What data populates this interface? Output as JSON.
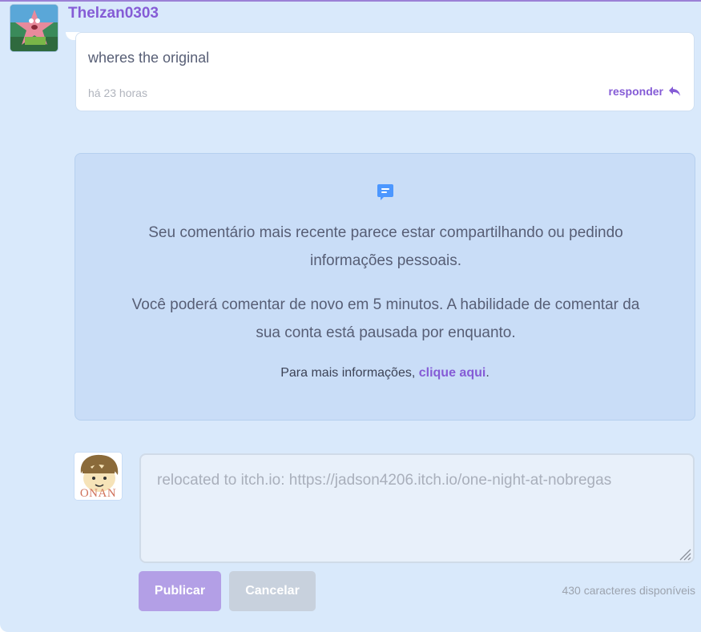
{
  "comment": {
    "author": "Thelzan0303",
    "text": "wheres the original",
    "time": "há 23 horas",
    "reply_label": "responder",
    "avatar_icon": "user-avatar-starfish"
  },
  "notice": {
    "icon": "chat-bubble-icon",
    "line1": "Seu comentário mais recente parece estar compartilhando ou pedindo informações pessoais.",
    "line2": "Você poderá comentar de novo em 5 minutos. A habilidade de comentar da sua conta está pausada por enquanto.",
    "more_info_prefix": "Para mais informações, ",
    "more_info_link": "clique aqui",
    "more_info_suffix": "."
  },
  "compose": {
    "avatar_text": "ONAN",
    "value": "relocated to itch.io: https://jadson4206.itch.io/one-night-at-nobregas",
    "publish_label": "Publicar",
    "cancel_label": "Cancelar",
    "chars_remaining": "430 caracteres disponíveis"
  },
  "colors": {
    "accent": "#855cd6",
    "background": "#d9e9fb",
    "notice_bg": "#c9ddf7"
  }
}
